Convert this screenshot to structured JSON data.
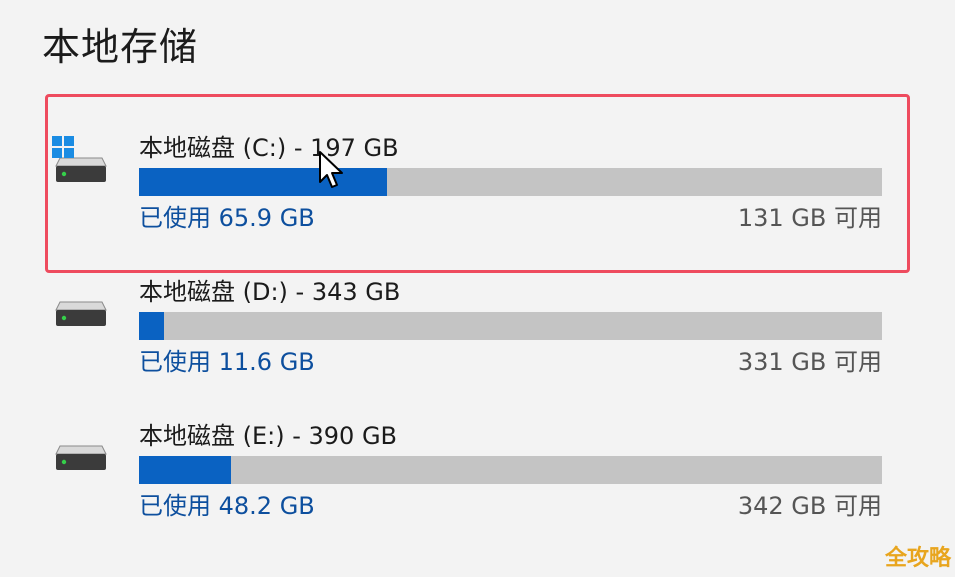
{
  "page": {
    "title": "本地存储"
  },
  "drives": [
    {
      "name": "本地磁盘 (C:) - 197 GB",
      "used_label": "已使用 65.9 GB",
      "free_label": "131 GB 可用",
      "used_fraction": 0.334,
      "system_drive": true,
      "highlighted": true
    },
    {
      "name": "本地磁盘 (D:) - 343 GB",
      "used_label": "已使用 11.6 GB",
      "free_label": "331 GB 可用",
      "used_fraction": 0.034,
      "system_drive": false,
      "highlighted": false
    },
    {
      "name": "本地磁盘 (E:) - 390 GB",
      "used_label": "已使用 48.2 GB",
      "free_label": "342 GB 可用",
      "used_fraction": 0.124,
      "system_drive": false,
      "highlighted": false
    }
  ],
  "icons": {
    "drive": "hard-drive-icon",
    "windows": "windows-logo-icon",
    "cursor": "mouse-pointer-icon"
  },
  "colors": {
    "bar_fill": "#0a62c2",
    "bar_track": "#c4c4c4",
    "used_text": "#0d4f9e",
    "highlight_border": "#ee4b5e",
    "background": "#f3f3f3"
  },
  "watermark": "全攻略"
}
